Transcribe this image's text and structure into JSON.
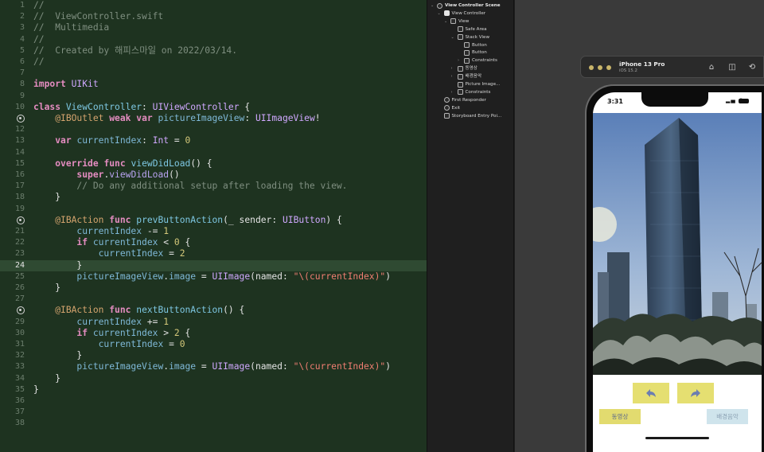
{
  "editor": {
    "current_line": 24,
    "lines": [
      {
        "n": 1,
        "text": "//"
      },
      {
        "n": 2,
        "text": "//  ViewController.swift"
      },
      {
        "n": 3,
        "text": "//  Multimedia"
      },
      {
        "n": 4,
        "text": "//"
      },
      {
        "n": 5,
        "text": "//  Created by 해피스마일 on 2022/03/14."
      },
      {
        "n": 6,
        "text": "//"
      },
      {
        "n": 7,
        "text": ""
      },
      {
        "n": 8,
        "text": "import UIKit"
      },
      {
        "n": 9,
        "text": ""
      },
      {
        "n": 10,
        "text": "class ViewController: UIViewController {"
      },
      {
        "n": 11,
        "text": "    @IBOutlet weak var pictureImageView: UIImageView!",
        "outlet": true
      },
      {
        "n": 12,
        "text": ""
      },
      {
        "n": 13,
        "text": "    var currentIndex: Int = 0"
      },
      {
        "n": 14,
        "text": ""
      },
      {
        "n": 15,
        "text": "    override func viewDidLoad() {"
      },
      {
        "n": 16,
        "text": "        super.viewDidLoad()"
      },
      {
        "n": 17,
        "text": "        // Do any additional setup after loading the view."
      },
      {
        "n": 18,
        "text": "    }"
      },
      {
        "n": 19,
        "text": ""
      },
      {
        "n": 20,
        "text": "    @IBAction func prevButtonAction(_ sender: UIButton) {",
        "outlet": true
      },
      {
        "n": 21,
        "text": "        currentIndex -= 1"
      },
      {
        "n": 22,
        "text": "        if currentIndex < 0 {"
      },
      {
        "n": 23,
        "text": "            currentIndex = 2"
      },
      {
        "n": 24,
        "text": "        }"
      },
      {
        "n": 25,
        "text": "        pictureImageView.image = UIImage(named: \"\\(currentIndex)\")"
      },
      {
        "n": 26,
        "text": "    }"
      },
      {
        "n": 27,
        "text": ""
      },
      {
        "n": 28,
        "text": "    @IBAction func nextButtonAction() {",
        "outlet": true
      },
      {
        "n": 29,
        "text": "        currentIndex += 1"
      },
      {
        "n": 30,
        "text": "        if currentIndex > 2 {"
      },
      {
        "n": 31,
        "text": "            currentIndex = 0"
      },
      {
        "n": 32,
        "text": "        }"
      },
      {
        "n": 33,
        "text": "        pictureImageView.image = UIImage(named: \"\\(currentIndex)\")"
      },
      {
        "n": 34,
        "text": "    }"
      },
      {
        "n": 35,
        "text": "}"
      },
      {
        "n": 36,
        "text": ""
      },
      {
        "n": 37,
        "text": ""
      },
      {
        "n": 38,
        "text": ""
      }
    ]
  },
  "outline": {
    "items": [
      {
        "label": "View Controller Scene",
        "depth": 0,
        "chevron": "⌄",
        "icon": "scene-icon",
        "scene": true
      },
      {
        "label": "View Controller",
        "depth": 1,
        "chevron": "⌄",
        "icon": "view-controller-icon"
      },
      {
        "label": "View",
        "depth": 2,
        "chevron": "⌄",
        "icon": "view-icon"
      },
      {
        "label": "Safe Area",
        "depth": 3,
        "chevron": "",
        "icon": "safe-area-icon"
      },
      {
        "label": "Stack View",
        "depth": 3,
        "chevron": "⌄",
        "icon": "stack-view-icon"
      },
      {
        "label": "Button",
        "depth": 4,
        "chevron": "",
        "icon": "button-icon"
      },
      {
        "label": "Button",
        "depth": 4,
        "chevron": "",
        "icon": "button-icon"
      },
      {
        "label": "Constraints",
        "depth": 4,
        "chevron": "›",
        "icon": "constraints-icon"
      },
      {
        "label": "동영상",
        "depth": 3,
        "chevron": "›",
        "icon": "button-icon"
      },
      {
        "label": "배경음악",
        "depth": 3,
        "chevron": "›",
        "icon": "button-icon"
      },
      {
        "label": "Picture Image...",
        "depth": 3,
        "chevron": "",
        "icon": "image-view-icon"
      },
      {
        "label": "Constraints",
        "depth": 3,
        "chevron": "›",
        "icon": "constraints-icon"
      },
      {
        "label": "First Responder",
        "depth": 1,
        "chevron": "",
        "icon": "first-responder-icon"
      },
      {
        "label": "Exit",
        "depth": 1,
        "chevron": "",
        "icon": "exit-icon"
      },
      {
        "label": "Storyboard Entry Poi...",
        "depth": 1,
        "chevron": "",
        "icon": "entry-point-icon"
      }
    ]
  },
  "simulator": {
    "device": "iPhone 13 Pro",
    "os": "iOS 15.2",
    "time": "3:31",
    "toolbar_icons": [
      "home-icon",
      "screenshot-icon",
      "rotate-icon"
    ],
    "buttons": {
      "prev_icon": "back-arrow-icon",
      "next_icon": "forward-arrow-icon",
      "video_label": "동영상",
      "bgm_label": "배경음악"
    },
    "colors": {
      "button_yellow": "#e5df71",
      "button_blue": "#cfe4ec"
    }
  }
}
